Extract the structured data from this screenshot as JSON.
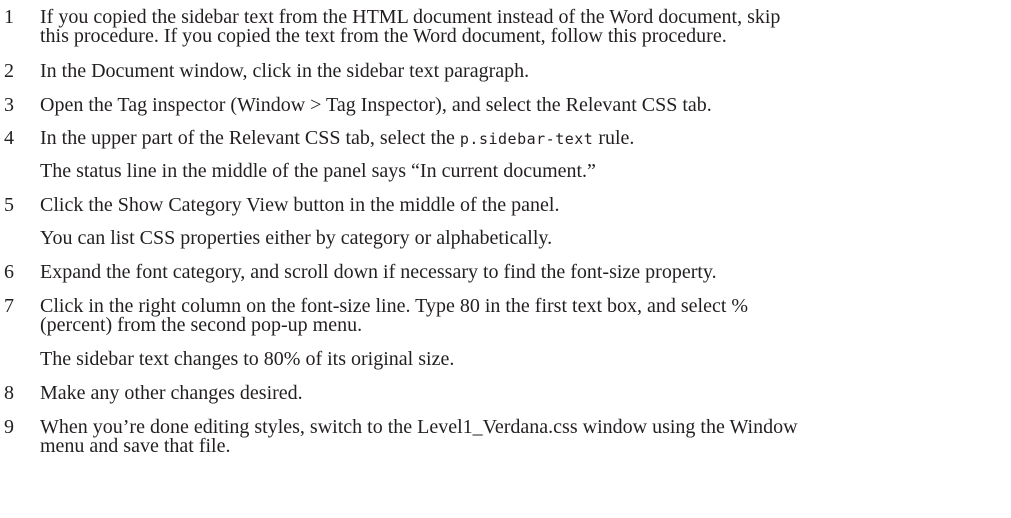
{
  "steps": [
    {
      "num": "1",
      "line1": "If you copied the sidebar text from the HTML document instead of the Word document, skip",
      "line2": "this procedure. If you copied the text from the Word document, follow this procedure."
    },
    {
      "num": "2",
      "text": "In the Document window, click in the sidebar text paragraph."
    },
    {
      "num": "3",
      "text": "Open the Tag inspector (Window > Tag Inspector), and select the Relevant CSS tab."
    },
    {
      "num": "4",
      "text_before": "In the upper part of the Relevant CSS tab, select the ",
      "code": "p.sidebar-text",
      "text_after": " rule.",
      "note": "The status line in the middle of the panel says “In current document.”"
    },
    {
      "num": "5",
      "text": "Click the Show Category View button in the middle of the panel.",
      "note": "You can list CSS properties either by category or alphabetically."
    },
    {
      "num": "6",
      "text": "Expand the font category, and scroll down if necessary to find the font-size property."
    },
    {
      "num": "7",
      "line1": "Click in the right column on the font-size line. Type 80 in the first text box, and select %",
      "line2": "(percent) from the second pop-up menu.",
      "note": "The sidebar text changes to 80% of its original size."
    },
    {
      "num": "8",
      "text": "Make any other changes desired."
    },
    {
      "num": "9",
      "line1": "When you’re done editing styles, switch to the Level1_Verdana.css window using the Window",
      "line2": "menu and save that file."
    }
  ]
}
